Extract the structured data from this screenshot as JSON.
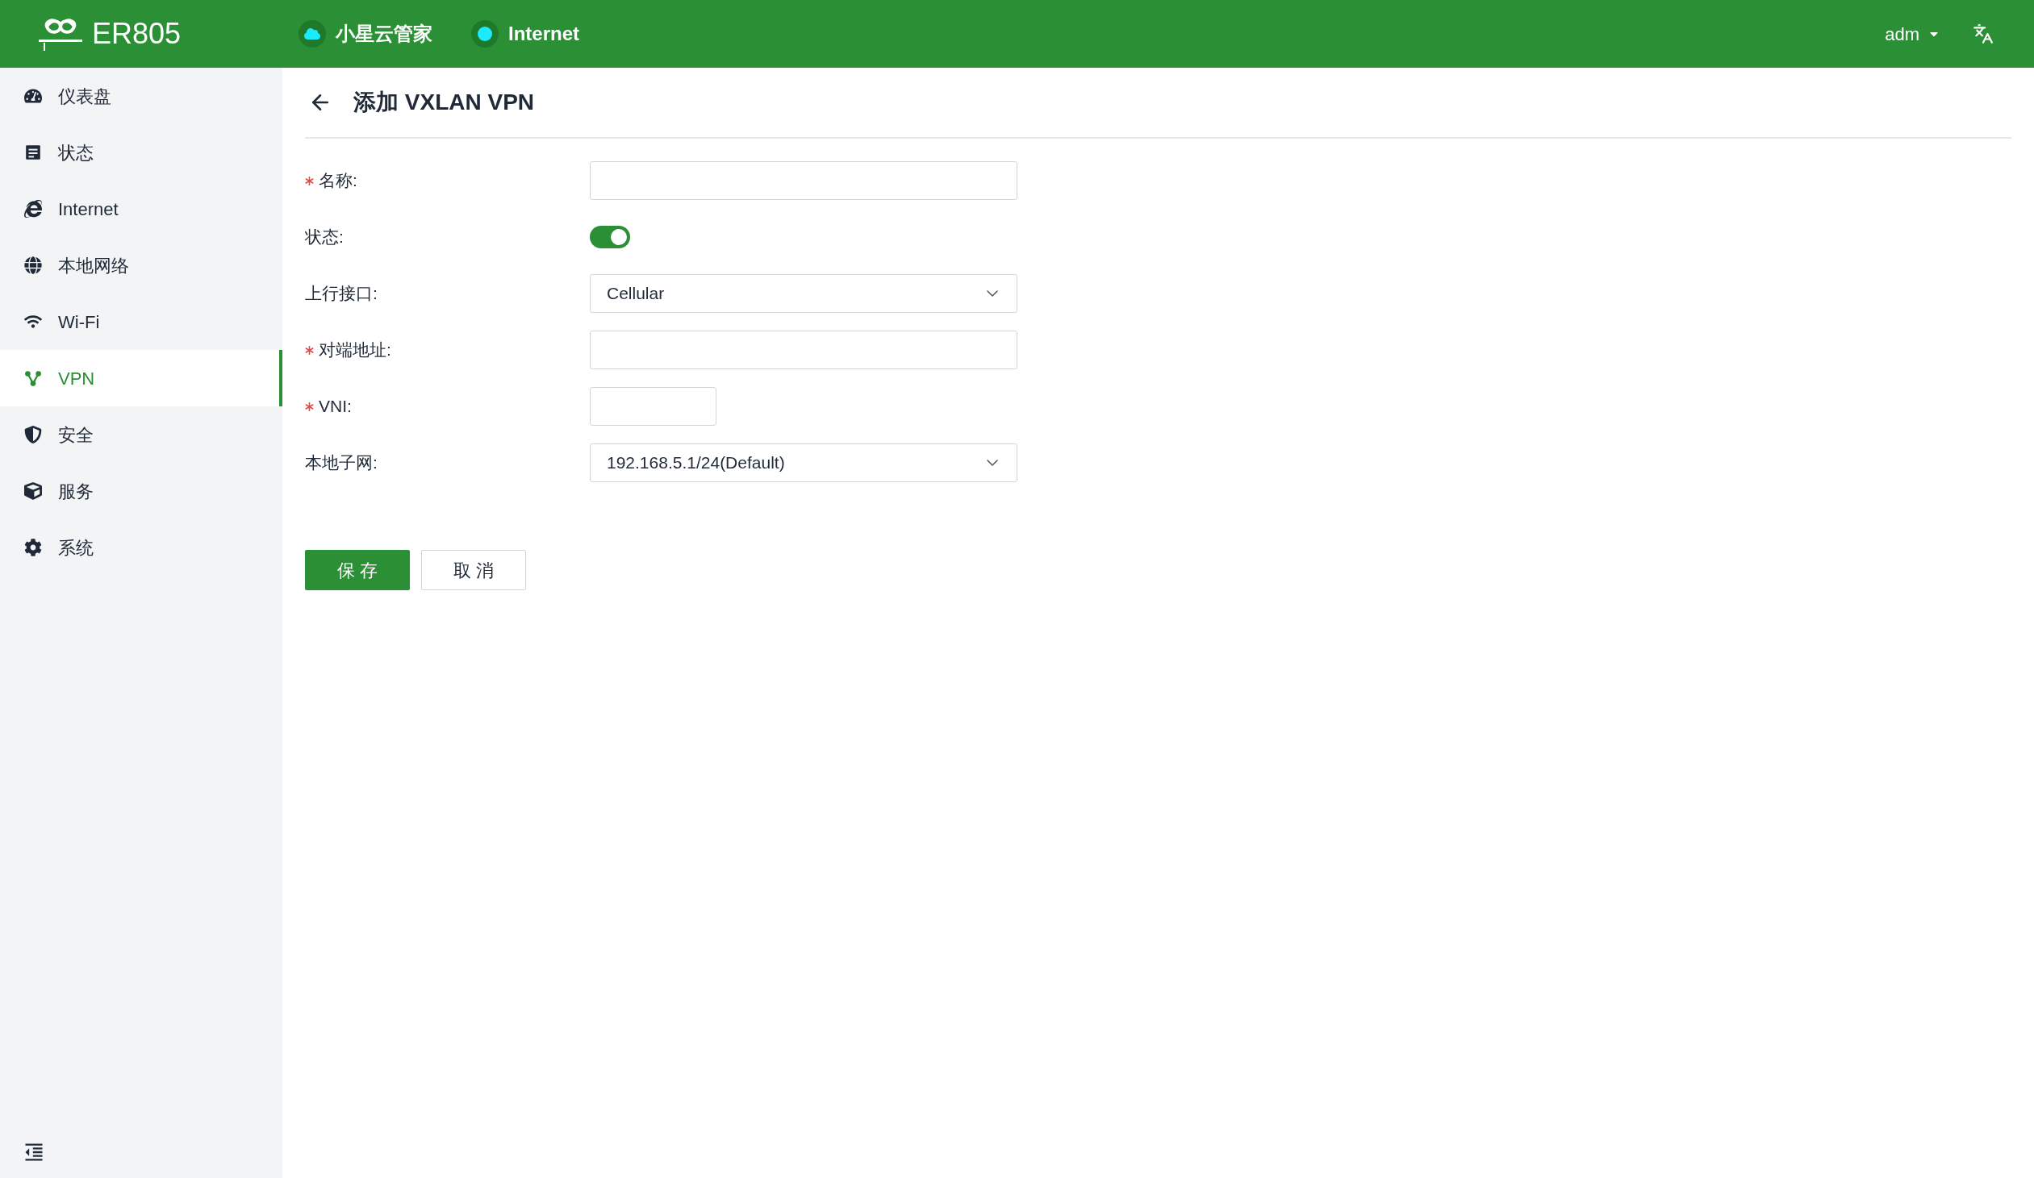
{
  "header": {
    "product": "ER805",
    "status": [
      {
        "kind": "cloud",
        "label": "小星云管家"
      },
      {
        "kind": "dot",
        "label": "Internet"
      }
    ],
    "user": "adm"
  },
  "sidebar": {
    "items": [
      {
        "label": "仪表盘",
        "selected": false
      },
      {
        "label": "状态",
        "selected": false
      },
      {
        "label": "Internet",
        "selected": false
      },
      {
        "label": "本地网络",
        "selected": false
      },
      {
        "label": "Wi-Fi",
        "selected": false
      },
      {
        "label": "VPN",
        "selected": true
      },
      {
        "label": "安全",
        "selected": false
      },
      {
        "label": "服务",
        "selected": false
      },
      {
        "label": "系统",
        "selected": false
      }
    ]
  },
  "page": {
    "title": "添加 VXLAN VPN"
  },
  "form": {
    "fields": [
      {
        "kind": "text",
        "label": "名称:",
        "required": true
      },
      {
        "kind": "switch",
        "label": "状态:",
        "required": false,
        "on": true
      },
      {
        "kind": "select",
        "label": "上行接口:",
        "required": false,
        "value": "Cellular"
      },
      {
        "kind": "text",
        "label": "对端地址:",
        "required": true
      },
      {
        "kind": "short",
        "label": "VNI:",
        "required": true
      },
      {
        "kind": "select",
        "label": "本地子网:",
        "required": false,
        "value": "192.168.5.1/24(Default)"
      }
    ],
    "buttons": [
      {
        "kind": "primary",
        "label": "保 存"
      },
      {
        "kind": "secondary",
        "label": "取 消"
      }
    ]
  }
}
